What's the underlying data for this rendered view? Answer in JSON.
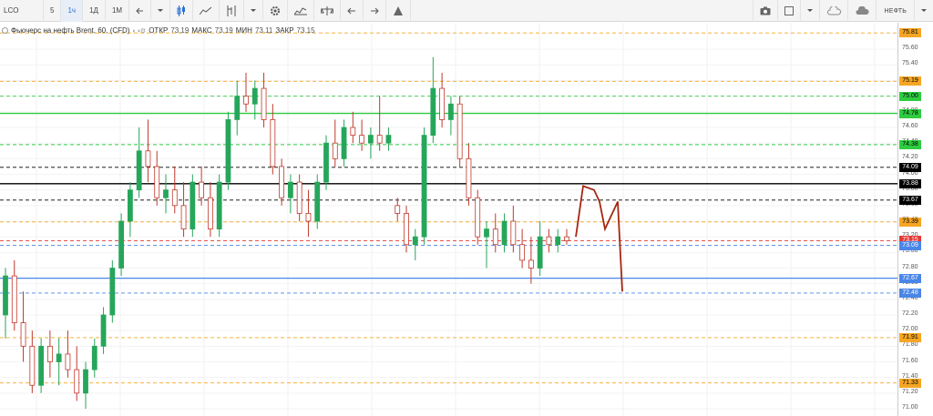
{
  "toolbar": {
    "symbol": "LCO",
    "intervals": [
      "5",
      "1ч",
      "1Д",
      "1М"
    ],
    "active_interval": "1ч",
    "right_label": "НЕФТЬ",
    "icons": [
      "back-arrow-icon",
      "dropdown-icon",
      "candles-icon",
      "line-chart-icon",
      "indicator-icon",
      "settings-icon",
      "compare-icon",
      "scale-icon",
      "undo-icon",
      "redo-icon",
      "alert-icon"
    ],
    "right_icons": [
      "camera-icon",
      "layout-icon",
      "cloud-icon",
      "cloud-upload-icon"
    ]
  },
  "legend": {
    "title": "Фьючерс на нефть Brent, 60, (CFD)",
    "open_label": "ОТКР",
    "open_value": "73.19",
    "high_label": "МАКС",
    "high_value": "73.19",
    "low_label": "МИН",
    "low_value": "73.11",
    "close_label": "ЗАКР",
    "close_value": "73.15"
  },
  "chart_data": {
    "type": "candlestick",
    "ylim": [
      71.0,
      75.8
    ],
    "axis_ticks": [
      "75.60",
      "75.40",
      "75.20",
      "75.00",
      "74.80",
      "74.60",
      "74.40",
      "74.20",
      "74.00",
      "73.80",
      "73.60",
      "73.40",
      "73.20",
      "73.00",
      "72.80",
      "72.60",
      "72.40",
      "72.20",
      "72.00",
      "71.80",
      "71.60",
      "71.40",
      "71.20",
      "71.00"
    ],
    "levels": [
      {
        "value": 75.81,
        "label": "75.81",
        "color": "#f5a623",
        "style": "dashed"
      },
      {
        "value": 75.19,
        "label": "75.19",
        "color": "#f5a623",
        "style": "dashed"
      },
      {
        "value": 75.0,
        "label": "75.00",
        "color": "#2ecc40",
        "style": "dashed"
      },
      {
        "value": 74.78,
        "label": "74.78",
        "color": "#2ecc40",
        "style": "solid"
      },
      {
        "value": 74.38,
        "label": "74.38",
        "color": "#2ecc40",
        "style": "dashed"
      },
      {
        "value": 74.09,
        "label": "74.09",
        "color": "#000000",
        "style": "dashed"
      },
      {
        "value": 73.88,
        "label": "73.88",
        "color": "#000000",
        "style": "solid"
      },
      {
        "value": 73.67,
        "label": "73.67",
        "color": "#000000",
        "style": "dashed"
      },
      {
        "value": 73.39,
        "label": "73.39",
        "color": "#f5a623",
        "style": "dashed"
      },
      {
        "value": 73.15,
        "label": "73.15",
        "color": "#e53935",
        "style": "dashed"
      },
      {
        "value": 73.09,
        "label": "73.09",
        "color": "#4a86e8",
        "style": "dashed"
      },
      {
        "value": 72.67,
        "label": "72.67",
        "color": "#4a86e8",
        "style": "solid"
      },
      {
        "value": 72.48,
        "label": "72.48",
        "color": "#4a86e8",
        "style": "dashed"
      },
      {
        "value": 71.91,
        "label": "71.91",
        "color": "#f5a623",
        "style": "dashed"
      },
      {
        "value": 71.33,
        "label": "71.33",
        "color": "#f5a623",
        "style": "dashed"
      }
    ],
    "candles": [
      [
        72.2,
        72.8,
        71.9,
        72.7
      ],
      [
        72.7,
        72.9,
        72.0,
        72.1
      ],
      [
        72.1,
        72.5,
        71.6,
        71.8
      ],
      [
        71.8,
        72.0,
        71.2,
        71.3
      ],
      [
        71.3,
        71.9,
        71.2,
        71.8
      ],
      [
        71.8,
        72.0,
        71.4,
        71.6
      ],
      [
        71.6,
        71.9,
        71.3,
        71.7
      ],
      [
        71.7,
        72.0,
        71.4,
        71.5
      ],
      [
        71.5,
        71.8,
        71.1,
        71.2
      ],
      [
        71.2,
        71.6,
        71.0,
        71.5
      ],
      [
        71.5,
        71.9,
        71.4,
        71.8
      ],
      [
        71.8,
        72.3,
        71.7,
        72.2
      ],
      [
        72.2,
        72.9,
        72.1,
        72.8
      ],
      [
        72.8,
        73.5,
        72.7,
        73.4
      ],
      [
        73.4,
        73.9,
        73.2,
        73.8
      ],
      [
        73.8,
        74.6,
        73.7,
        74.3
      ],
      [
        74.3,
        74.7,
        73.9,
        74.1
      ],
      [
        74.1,
        74.3,
        73.6,
        73.7
      ],
      [
        73.7,
        74.0,
        73.5,
        73.8
      ],
      [
        73.8,
        74.1,
        73.5,
        73.6
      ],
      [
        73.6,
        73.9,
        73.2,
        73.3
      ],
      [
        73.3,
        74.0,
        73.2,
        73.9
      ],
      [
        73.9,
        74.1,
        73.6,
        73.7
      ],
      [
        73.7,
        73.9,
        73.2,
        73.3
      ],
      [
        73.3,
        74.0,
        73.2,
        73.9
      ],
      [
        73.9,
        74.8,
        73.8,
        74.7
      ],
      [
        74.7,
        75.2,
        74.5,
        75.0
      ],
      [
        75.0,
        75.3,
        74.8,
        74.9
      ],
      [
        74.9,
        75.2,
        74.7,
        75.1
      ],
      [
        75.1,
        75.3,
        74.6,
        74.7
      ],
      [
        74.7,
        74.9,
        74.0,
        74.1
      ],
      [
        74.1,
        74.2,
        73.6,
        73.7
      ],
      [
        73.7,
        74.0,
        73.5,
        73.9
      ],
      [
        73.9,
        74.0,
        73.4,
        73.5
      ],
      [
        73.5,
        73.8,
        73.2,
        73.4
      ],
      [
        73.4,
        74.0,
        73.3,
        73.9
      ],
      [
        73.9,
        74.5,
        73.8,
        74.4
      ],
      [
        74.4,
        74.7,
        74.1,
        74.2
      ],
      [
        74.2,
        74.7,
        74.1,
        74.6
      ],
      [
        74.6,
        74.8,
        74.4,
        74.5
      ],
      [
        74.5,
        74.7,
        74.3,
        74.4
      ],
      [
        74.4,
        74.6,
        74.2,
        74.5
      ],
      [
        74.5,
        75.0,
        74.3,
        74.4
      ],
      [
        74.4,
        74.6,
        74.3,
        74.5
      ],
      [
        73.6,
        73.7,
        73.4,
        73.5
      ],
      [
        73.5,
        73.6,
        73.0,
        73.1
      ],
      [
        73.1,
        73.3,
        72.9,
        73.2
      ],
      [
        73.2,
        74.6,
        73.1,
        74.5
      ],
      [
        74.5,
        75.5,
        74.4,
        75.1
      ],
      [
        75.1,
        75.3,
        74.6,
        74.7
      ],
      [
        74.7,
        75.0,
        74.5,
        74.9
      ],
      [
        74.9,
        75.0,
        74.1,
        74.2
      ],
      [
        74.2,
        74.4,
        73.6,
        73.7
      ],
      [
        73.7,
        73.8,
        73.1,
        73.2
      ],
      [
        73.2,
        73.4,
        72.8,
        73.3
      ],
      [
        73.3,
        73.5,
        73.0,
        73.1
      ],
      [
        73.1,
        73.5,
        73.0,
        73.4
      ],
      [
        73.4,
        73.6,
        73.0,
        73.1
      ],
      [
        73.1,
        73.3,
        72.8,
        72.9
      ],
      [
        72.9,
        73.2,
        72.6,
        72.8
      ],
      [
        72.8,
        73.4,
        72.7,
        73.2
      ],
      [
        73.2,
        73.3,
        73.0,
        73.1
      ],
      [
        73.1,
        73.3,
        73.0,
        73.2
      ],
      [
        73.2,
        73.3,
        73.1,
        73.15
      ]
    ],
    "drawn_path": [
      [
        73.2
      ],
      [
        73.85
      ],
      [
        73.8
      ],
      [
        73.65
      ],
      [
        73.3
      ],
      [
        73.65
      ],
      [
        72.5
      ]
    ]
  }
}
